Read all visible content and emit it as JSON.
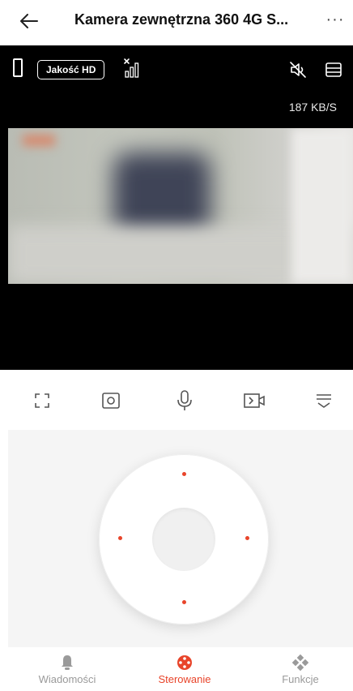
{
  "header": {
    "title": "Kamera zewnętrzna 360 4G S...",
    "more_label": "···"
  },
  "video": {
    "quality_label": "Jakość HD",
    "speed": "187 KB/S"
  },
  "toolbar": {
    "icons": [
      "fullscreen-icon",
      "snapshot-icon",
      "microphone-icon",
      "record-icon",
      "collapse-icon"
    ]
  },
  "nav": {
    "items": [
      {
        "label": "Wiadomości",
        "icon": "bell-icon",
        "active": false
      },
      {
        "label": "Sterowanie",
        "icon": "control-icon",
        "active": true
      },
      {
        "label": "Funkcje",
        "icon": "features-icon",
        "active": false
      }
    ]
  },
  "colors": {
    "accent": "#e8442a",
    "video_bg": "#000000",
    "pad_bg": "#f5f5f5"
  }
}
